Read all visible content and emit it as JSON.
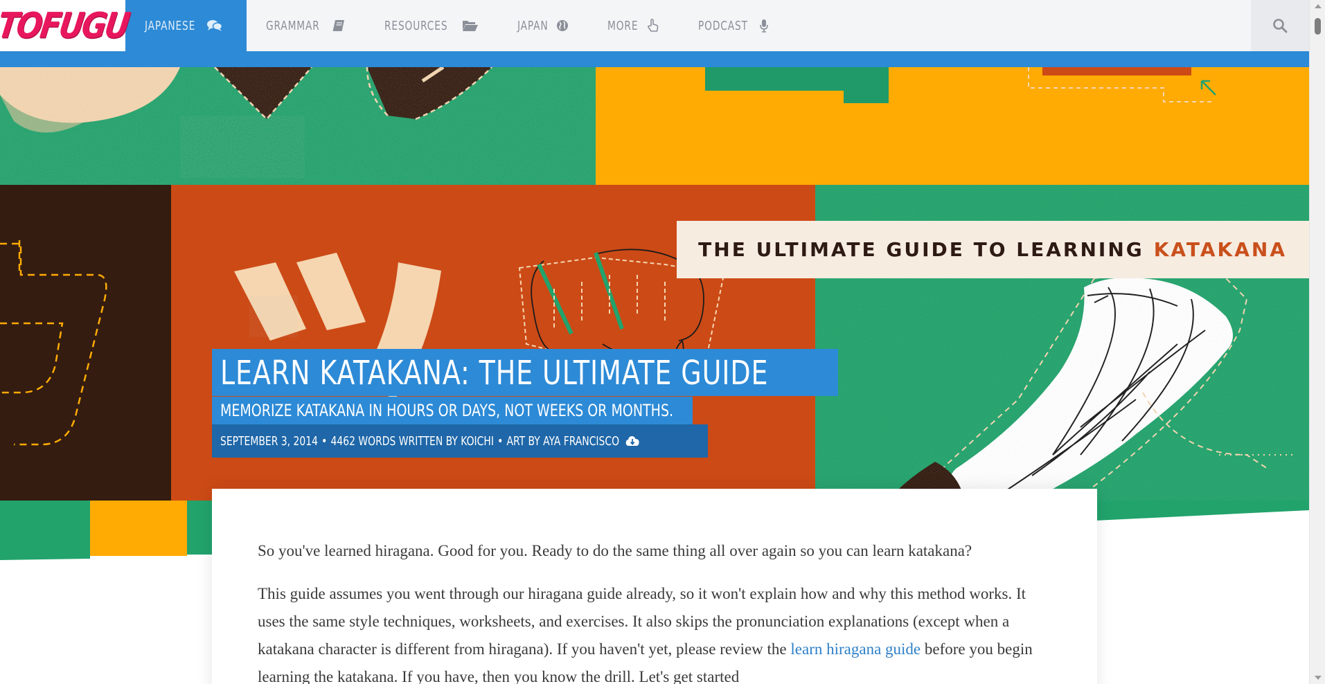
{
  "site": {
    "logo": "TOFUGU"
  },
  "nav": {
    "items": [
      {
        "label": "JAPANESE",
        "icon": "comments-icon"
      },
      {
        "label": "GRAMMAR",
        "icon": "book-icon"
      },
      {
        "label": "RESOURCES",
        "icon": "folder-open-icon"
      },
      {
        "label": "JAPAN",
        "icon": "globe-icon"
      },
      {
        "label": "MORE",
        "icon": "hand-pointer-icon"
      },
      {
        "label": "PODCAST",
        "icon": "microphone-icon"
      }
    ],
    "active": "JAPANESE",
    "search_icon": "search-icon"
  },
  "hero": {
    "banner": {
      "prefix": "THE ULTIMATE GUIDE TO LEARNING",
      "highlight": "KATAKANA"
    },
    "title": "LEARN KATAKANA: THE ULTIMATE GUIDE",
    "subtitle": "MEMORIZE KATAKANA IN HOURS OR DAYS, NOT WEEKS OR MONTHS.",
    "meta": {
      "date": "SEPTEMBER 3, 2014",
      "words": "4462 WORDS WRITTEN BY KOICHI",
      "art": "ART BY AYA FRANCISCO",
      "download_icon": "cloud-download-icon"
    }
  },
  "article": {
    "p1": "So you've learned hiragana. Good for you. Ready to do the same thing all over again so you can learn katakana?",
    "p2_before": "This guide assumes you went through our hiragana guide already, so it won't explain how and why this method works. It uses the same style techniques, worksheets, and exercises. It also skips the pronunciation explanations (except when a katakana character is different from hiragana). If you haven't yet, please review the ",
    "p2_link": "learn hiragana guide",
    "p2_after": " before you begin learning the katakana. If you have, then you know the drill. Let's get started"
  },
  "colors": {
    "accent": "#2d8ad6",
    "meta_bg": "#1f67a8",
    "logo": "#e8175d",
    "hero_green": "#22a36c",
    "hero_orange": "#cc4a16",
    "hero_yellow": "#ffab04",
    "hero_brown": "#341c10"
  }
}
